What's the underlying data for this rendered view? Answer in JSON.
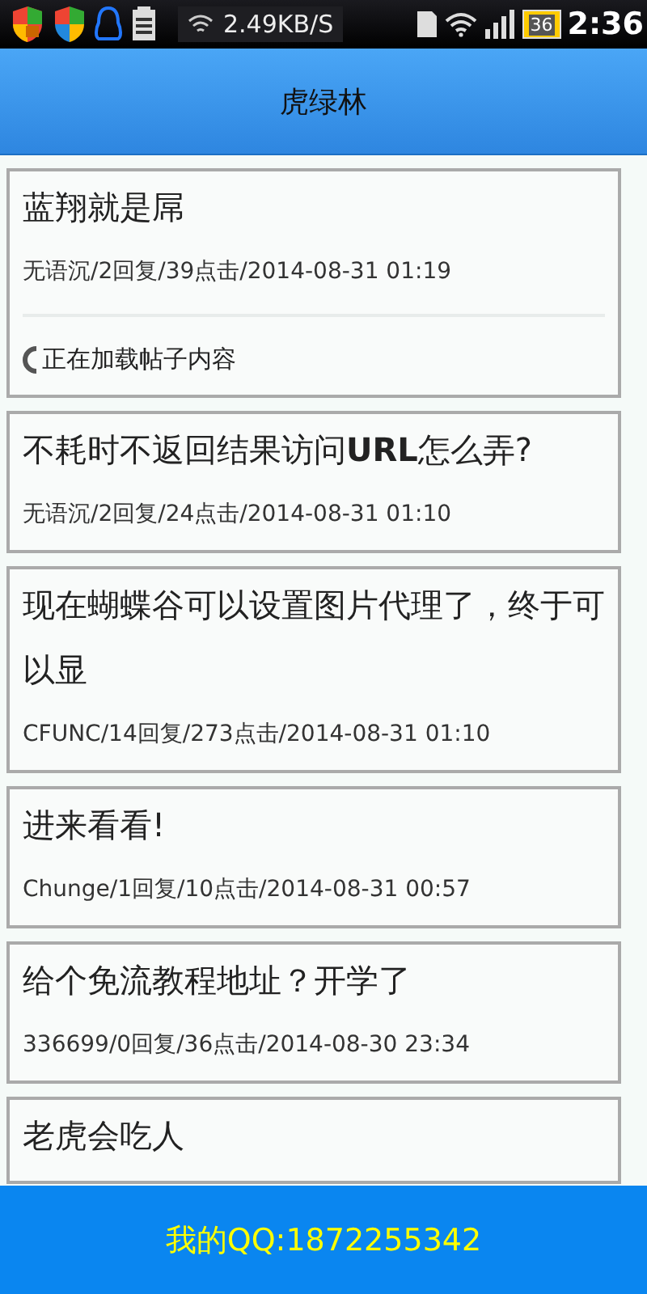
{
  "status_bar": {
    "speed": "2.49KB/S",
    "battery_label": "36",
    "time": "2:36"
  },
  "header": {
    "title": "虎绿林"
  },
  "posts": [
    {
      "title": "蓝翔就是屌",
      "meta": "无语沉/2回复/39点击/2014-08-31 01:19",
      "loading": "正在加载帖子内容"
    },
    {
      "title": "不耗时不返回结果访问**URL**怎么弄?",
      "meta": "无语沉/2回复/24点击/2014-08-31 01:10"
    },
    {
      "title": "现在蝴蝶谷可以设置图片代理了，终于可以显",
      "meta": "CFUNC/14回复/273点击/2014-08-31 01:10"
    },
    {
      "title": "进来看看!",
      "meta": "Chunge/1回复/10点击/2014-08-31 00:57"
    },
    {
      "title": "给个免流教程地址？开学了",
      "meta": "336699/0回复/36点击/2014-08-30 23:34"
    },
    {
      "title": "老虎会吃人"
    }
  ],
  "footer": {
    "text": "我的QQ:1872255342"
  }
}
